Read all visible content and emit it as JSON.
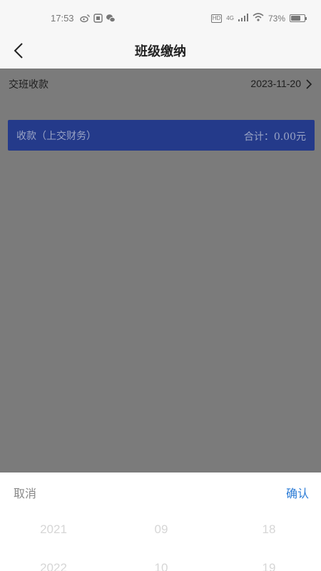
{
  "status_bar": {
    "time": "17:53",
    "hd": "HD",
    "network": "4G",
    "battery_text": "73%",
    "battery_level": 0.73
  },
  "nav": {
    "title": "班级缴纳",
    "back_icon": "chevron-left-icon"
  },
  "content": {
    "row_label": "交班收款",
    "row_date": "2023-11-20",
    "summary_label": "收款（上交财务）",
    "summary_total": "合计：0.00元",
    "summary_color": "#243a8a"
  },
  "picker": {
    "cancel": "取消",
    "confirm": "确认",
    "confirm_color": "#2a7bd6",
    "years": [
      "2021",
      "2022"
    ],
    "months": [
      "09",
      "10"
    ],
    "days": [
      "18",
      "19"
    ]
  }
}
